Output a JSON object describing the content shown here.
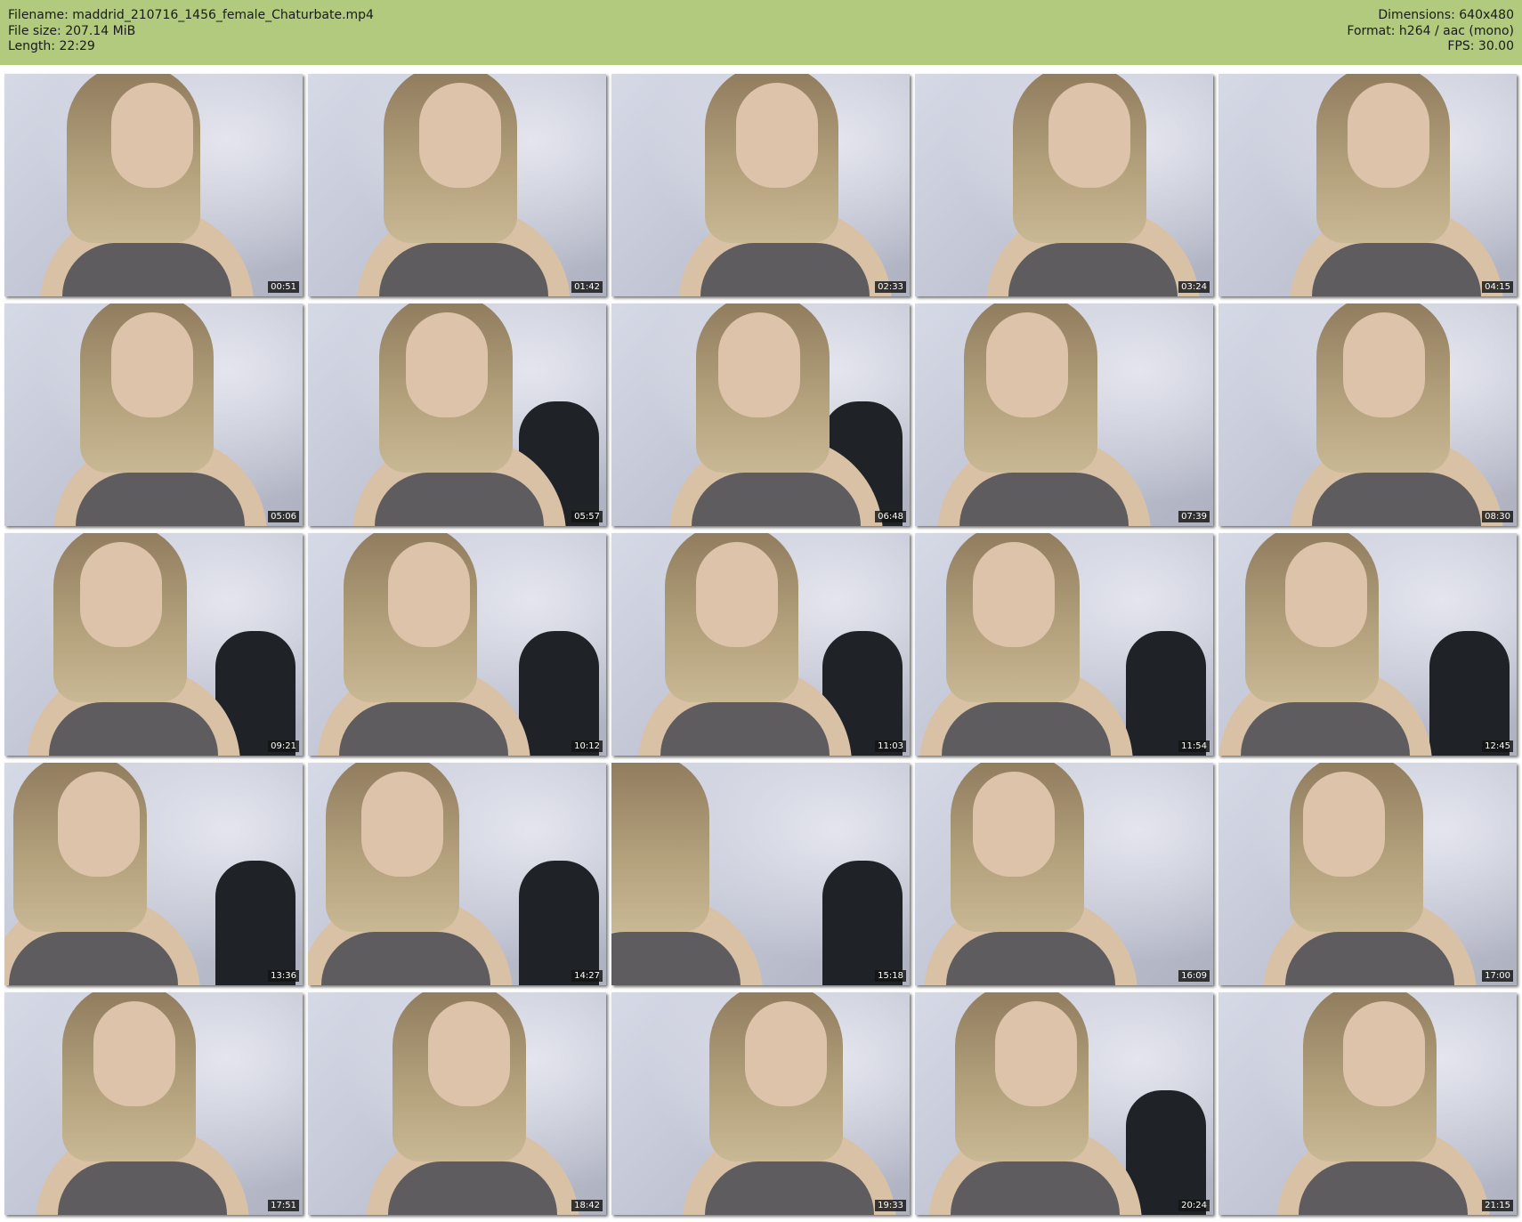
{
  "header": {
    "filename": "Filename: maddrid_210716_1456_female_Chaturbate.mp4",
    "filesize": "File size: 207.14 MiB",
    "length": "Length: 22:29",
    "dimensions": "Dimensions: 640x480",
    "format": "Format: h264 / aac (mono)",
    "fps": "FPS: 30.00"
  },
  "colors": {
    "header_background": "#b2ca7e",
    "timestamp_background": "#141414"
  },
  "thumbnails": [
    {
      "time": "00:51"
    },
    {
      "time": "01:42"
    },
    {
      "time": "02:33"
    },
    {
      "time": "03:24"
    },
    {
      "time": "04:15"
    },
    {
      "time": "05:06"
    },
    {
      "time": "05:57"
    },
    {
      "time": "06:48"
    },
    {
      "time": "07:39"
    },
    {
      "time": "08:30"
    },
    {
      "time": "09:21"
    },
    {
      "time": "10:12"
    },
    {
      "time": "11:03"
    },
    {
      "time": "11:54"
    },
    {
      "time": "12:45"
    },
    {
      "time": "13:36"
    },
    {
      "time": "14:27"
    },
    {
      "time": "15:18"
    },
    {
      "time": "16:09"
    },
    {
      "time": "17:00"
    },
    {
      "time": "17:51"
    },
    {
      "time": "18:42"
    },
    {
      "time": "19:33"
    },
    {
      "time": "20:24"
    },
    {
      "time": "21:15"
    }
  ]
}
